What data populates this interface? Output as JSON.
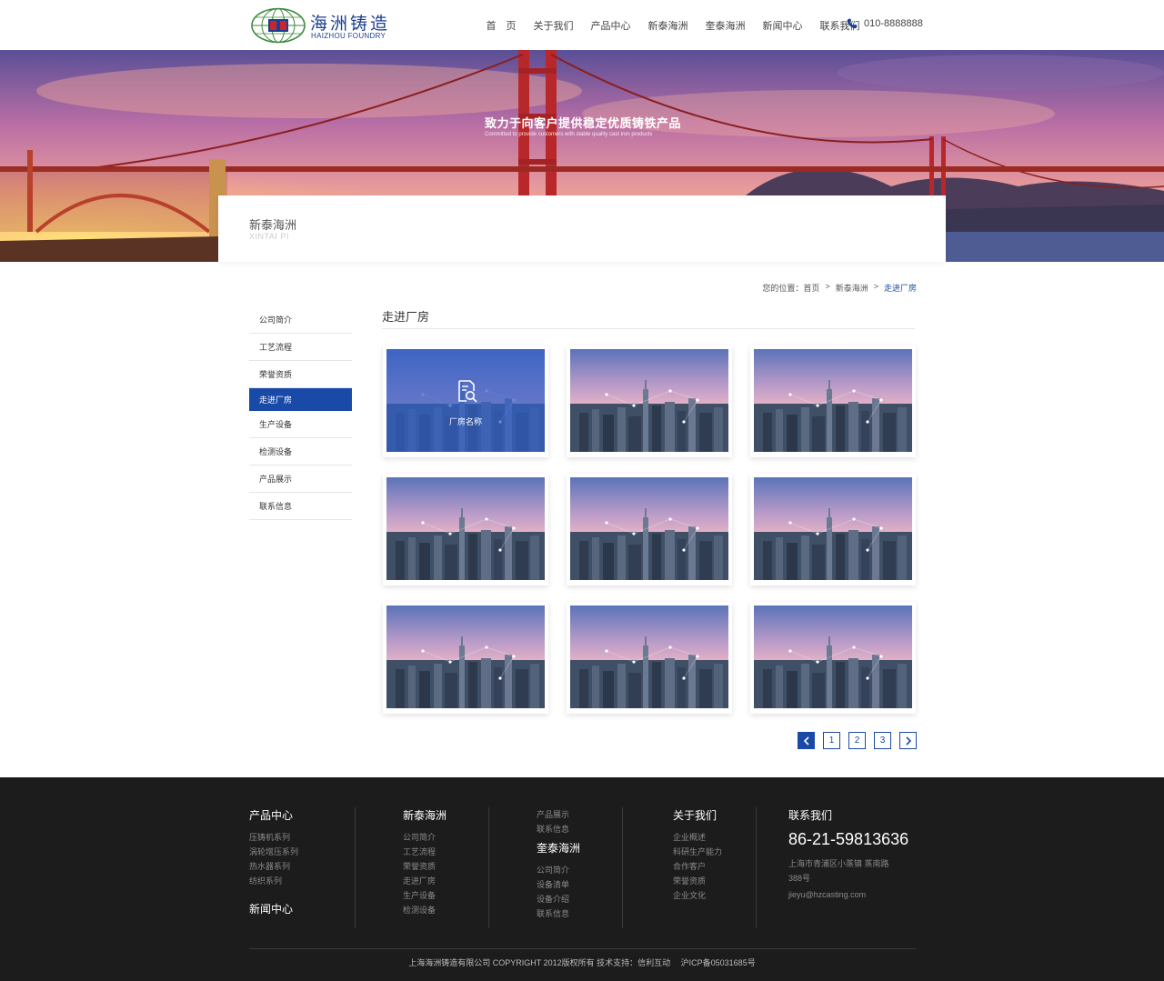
{
  "header": {
    "logo_cn": "海洲铸造",
    "logo_en": "HAIZHOU FOUNDRY",
    "nav": [
      "首　页",
      "关于我们",
      "产品中心",
      "新泰海洲",
      "奎泰海洲",
      "新闻中心",
      "联系我们"
    ],
    "phone": "010-8888888"
  },
  "banner": {
    "title": "致力于向客户提供稳定优质铸铁产品",
    "subtitle": "Committed to provide customers with stable quality cast iron products"
  },
  "title_card": {
    "cn": "新泰海洲",
    "en": "XINTAI PI"
  },
  "breadcrumb": {
    "prefix": "您的位置：首页",
    "sep": ">",
    "level1": "新泰海洲",
    "current": "走进厂房"
  },
  "sidebar": {
    "items": [
      "公司简介",
      "工艺流程",
      "荣誉资质",
      "走进厂房",
      "生产设备",
      "检测设备",
      "产品展示",
      "联系信息"
    ],
    "active_index": 3
  },
  "main": {
    "section_title": "走进厂房",
    "cards": [
      {
        "label": "厂房名称",
        "hover": true
      },
      {
        "label": "",
        "hover": false
      },
      {
        "label": "",
        "hover": false
      },
      {
        "label": "",
        "hover": false
      },
      {
        "label": "",
        "hover": false
      },
      {
        "label": "",
        "hover": false
      },
      {
        "label": "",
        "hover": false
      },
      {
        "label": "",
        "hover": false
      },
      {
        "label": "",
        "hover": false
      }
    ]
  },
  "pager": {
    "pages": [
      "1",
      "2",
      "3"
    ]
  },
  "footer": {
    "col1": {
      "title": "产品中心",
      "links": [
        "压铸机系列",
        "涡轮增压系列",
        "热水器系列",
        "纺织系列"
      ],
      "title2": "新闻中心"
    },
    "col2": {
      "title": "新泰海洲",
      "links": [
        "公司简介",
        "工艺流程",
        "荣誉资质",
        "走进厂房",
        "生产设备",
        "检测设备"
      ]
    },
    "col3": {
      "links_top": [
        "产品展示",
        "联系信息"
      ],
      "title": "奎泰海洲",
      "links": [
        "公司简介",
        "设备清单",
        "设备介绍",
        "联系信息"
      ]
    },
    "col4": {
      "title": "关于我们",
      "links": [
        "企业概述",
        "科研生产能力",
        "合作客户",
        "荣誉资质",
        "企业文化"
      ]
    },
    "col5": {
      "title": "联系我们",
      "phone": "86-21-59813636",
      "address": "上海市青浦区小蒸镇 蒸南路388号",
      "email": "jieyu@hzcasting.com"
    },
    "copyright": "上海海洲铸造有限公司 COPYRIGHT 2012版权所有 技术支持：信利互动　 沪ICP备05031685号"
  },
  "colors": {
    "accent": "#1a4aa8",
    "footer_bg": "#1c1c1c"
  }
}
